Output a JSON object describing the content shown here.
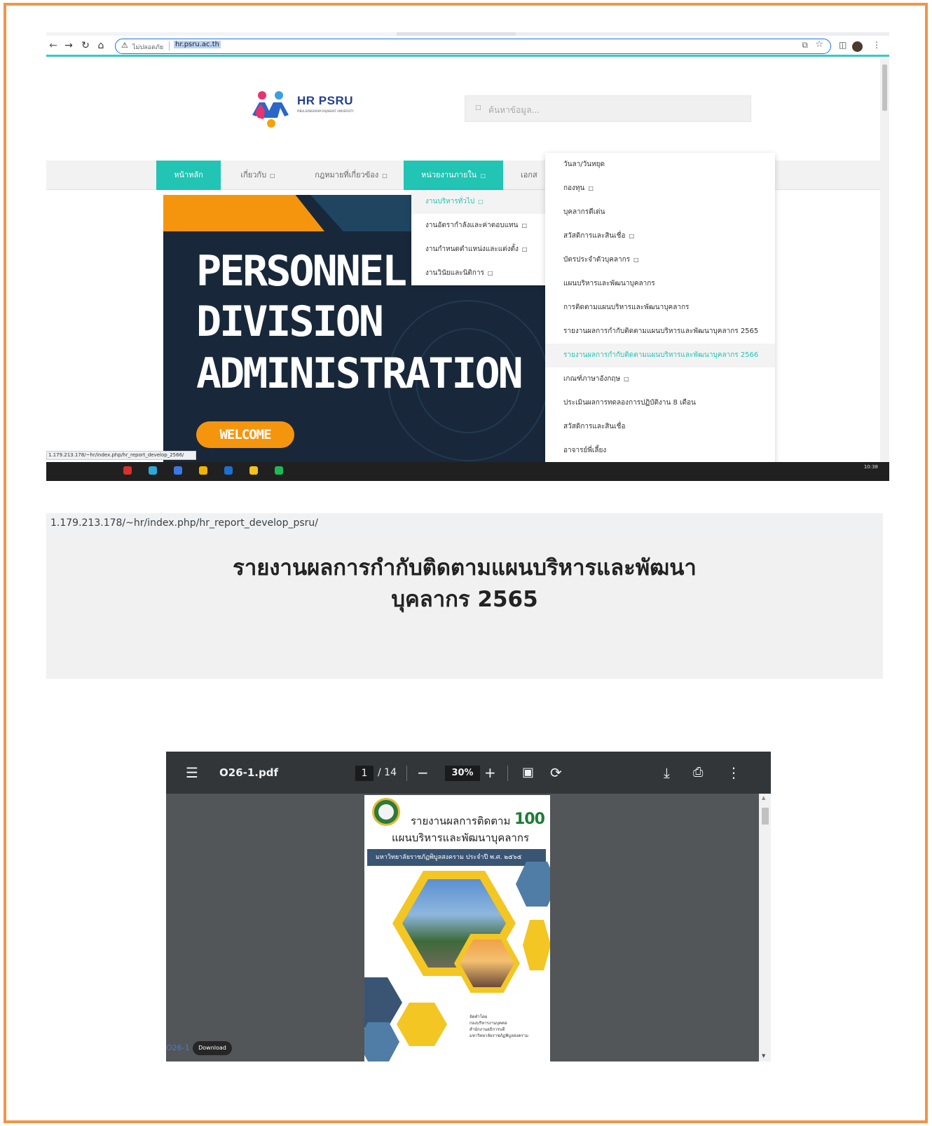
{
  "browser": {
    "security_label": "ไม่ปลอดภัย",
    "url": "hr.psru.ac.th",
    "status_url": "1.179.213.178/~hr/index.php/hr_report_develop_2566/",
    "clock": "10:38"
  },
  "site": {
    "logo_name": "HR PSRU",
    "logo_sub": "PIBULSONGKRAM RAJABHAT UNIVERSITY",
    "search_placeholder": "ค้นหาข้อมูล..."
  },
  "nav": {
    "items": [
      "หน้าหลัก",
      "เกี่ยวกับ",
      "กฎหมายที่เกี่ยวข้อง",
      "หน่วยงานภายใน",
      "เอกส"
    ],
    "active": "หน่วยงานภายใน"
  },
  "hero": {
    "line1": "PERSONNEL",
    "line2": "DIVISION",
    "line3": "ADMINISTRATION",
    "button": "WELCOME"
  },
  "submenu1": {
    "items": [
      "งานบริหารทั่วไป",
      "งานอัตรากำลังและค่าตอบแทน",
      "งานกำหนดตำแหน่งและแต่งตั้ง",
      "งานวินัยและนิติการ"
    ]
  },
  "submenu2": {
    "items": [
      "วันลา/วันหยุด",
      "กองทุน",
      "บุคลากรดีเด่น",
      "สวัสดิการและสินเชื่อ",
      "บัตรประจำตัวบุคลากร",
      "แผนบริหารและพัฒนาบุคลากร",
      "การติดตามแผนบริหารและพัฒนาบุคลากร",
      "รายงานผลการกำกับติดตามแผนบริหารและพัฒนาบุคลากร 2565",
      "รายงานผลการกำกับติดตามแผนบริหารและพัฒนาบุคลากร 2566",
      "เกณฑ์ภาษาอังกฤษ",
      "ประเมินผลการทดลองการปฏิบัติงาน 8 เดือน",
      "สวัสดิการและสินเชื่อ",
      "อาจารย์พี่เลี้ยง"
    ]
  },
  "report_page": {
    "url": "1.179.213.178/~hr/index.php/hr_report_develop_psru/",
    "title_line1": "รายงานผลการกำกับติดตามแผนบริหารและพัฒนา",
    "title_line2": "บุคลากร 2565"
  },
  "pdf": {
    "filename": "O26-1.pdf",
    "page": "1",
    "page_total": "/ 14",
    "zoom": "30%",
    "cover_line1": "รายงานผลการติดตาม",
    "cover_line2": "แผนบริหารและพัฒนาบุคลากร",
    "cover_band": "มหาวิทยาลัยราชภัฏพิบูลสงคราม ประจำปี พ.ศ. ๒๕๖๕",
    "cover_badge": "100",
    "cover_footer": [
      "จัดทำโดย",
      "กองบริหารงานบุคคล",
      "สำนักงานอธิการบดี",
      "มหาวิทยาลัยราชภัฏพิบูลสงคราม"
    ]
  },
  "download": {
    "link": "O26-1",
    "button": "Download"
  },
  "colors": {
    "accent_teal": "#22c4b3",
    "frame_orange": "#f0954a",
    "hero_orange": "#f5950d"
  }
}
